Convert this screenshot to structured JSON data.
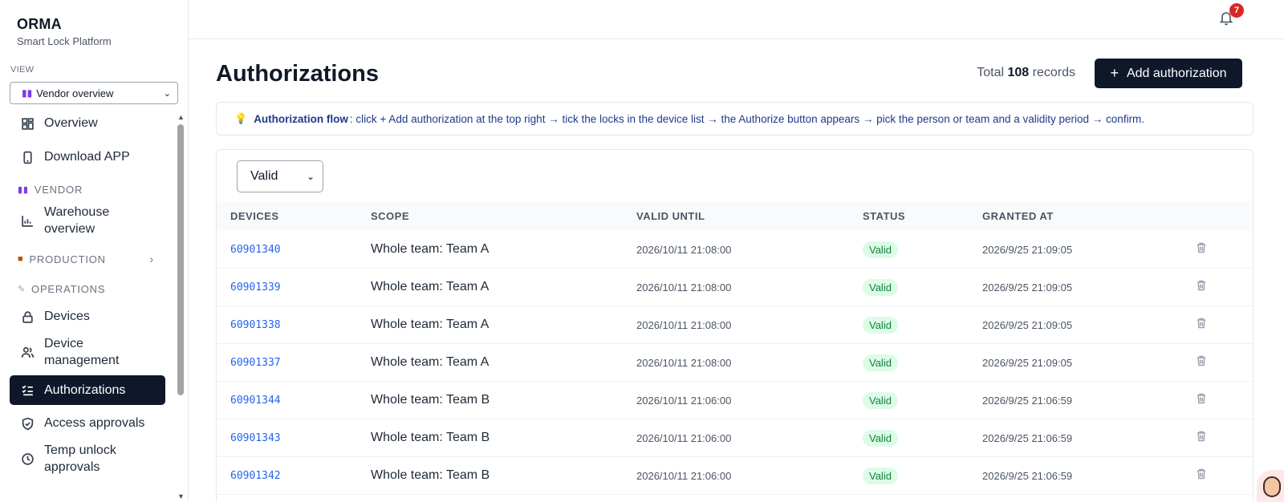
{
  "brand": {
    "name": "ORMA",
    "subtitle": "Smart Lock Platform"
  },
  "view": {
    "label": "VIEW",
    "selected": "Vendor overview"
  },
  "sidebar": {
    "items": [
      {
        "label": "Overview",
        "icon": "grid-icon"
      },
      {
        "label": "Download APP",
        "icon": "phone-icon"
      },
      {
        "section": "VENDOR"
      },
      {
        "label": "Warehouse overview",
        "icon": "warehouse-chart-icon"
      },
      {
        "section": "PRODUCTION"
      },
      {
        "section": "OPERATIONS"
      },
      {
        "label": "Devices",
        "icon": "lock-icon"
      },
      {
        "label": "Device management",
        "icon": "users-icon"
      },
      {
        "label": "Authorizations",
        "icon": "checklist-icon",
        "active": true
      },
      {
        "label": "Access approvals",
        "icon": "shield-check-icon"
      },
      {
        "label": "Temp unlock approvals",
        "icon": "clock-icon"
      }
    ]
  },
  "notifications": {
    "count": "7"
  },
  "main": {
    "title": "Authorizations",
    "total_prefix": "Total",
    "total_count": "108",
    "total_suffix": "records",
    "add_button": "Add authorization",
    "flow_bold": "Authorization flow",
    "flow_text": ": click + Add authorization at the top right → tick the locks in the device list → the Authorize button appears → pick the person or team and a validity period → confirm.",
    "filter": "Valid"
  },
  "table": {
    "columns": [
      "DEVICES",
      "SCOPE",
      "VALID UNTIL",
      "STATUS",
      "GRANTED AT"
    ],
    "rows": [
      {
        "device": "60901340",
        "scope": "Whole team: Team A",
        "until": "2026/10/11 21:08:00",
        "status": "Valid",
        "granted": "2026/9/25 21:09:05"
      },
      {
        "device": "60901339",
        "scope": "Whole team: Team A",
        "until": "2026/10/11 21:08:00",
        "status": "Valid",
        "granted": "2026/9/25 21:09:05"
      },
      {
        "device": "60901338",
        "scope": "Whole team: Team A",
        "until": "2026/10/11 21:08:00",
        "status": "Valid",
        "granted": "2026/9/25 21:09:05"
      },
      {
        "device": "60901337",
        "scope": "Whole team: Team A",
        "until": "2026/10/11 21:08:00",
        "status": "Valid",
        "granted": "2026/9/25 21:09:05"
      },
      {
        "device": "60901344",
        "scope": "Whole team: Team B",
        "until": "2026/10/11 21:06:00",
        "status": "Valid",
        "granted": "2026/9/25 21:06:59"
      },
      {
        "device": "60901343",
        "scope": "Whole team: Team B",
        "until": "2026/10/11 21:06:00",
        "status": "Valid",
        "granted": "2026/9/25 21:06:59"
      },
      {
        "device": "60901342",
        "scope": "Whole team: Team B",
        "until": "2026/10/11 21:06:00",
        "status": "Valid",
        "granted": "2026/9/25 21:06:59"
      }
    ]
  }
}
